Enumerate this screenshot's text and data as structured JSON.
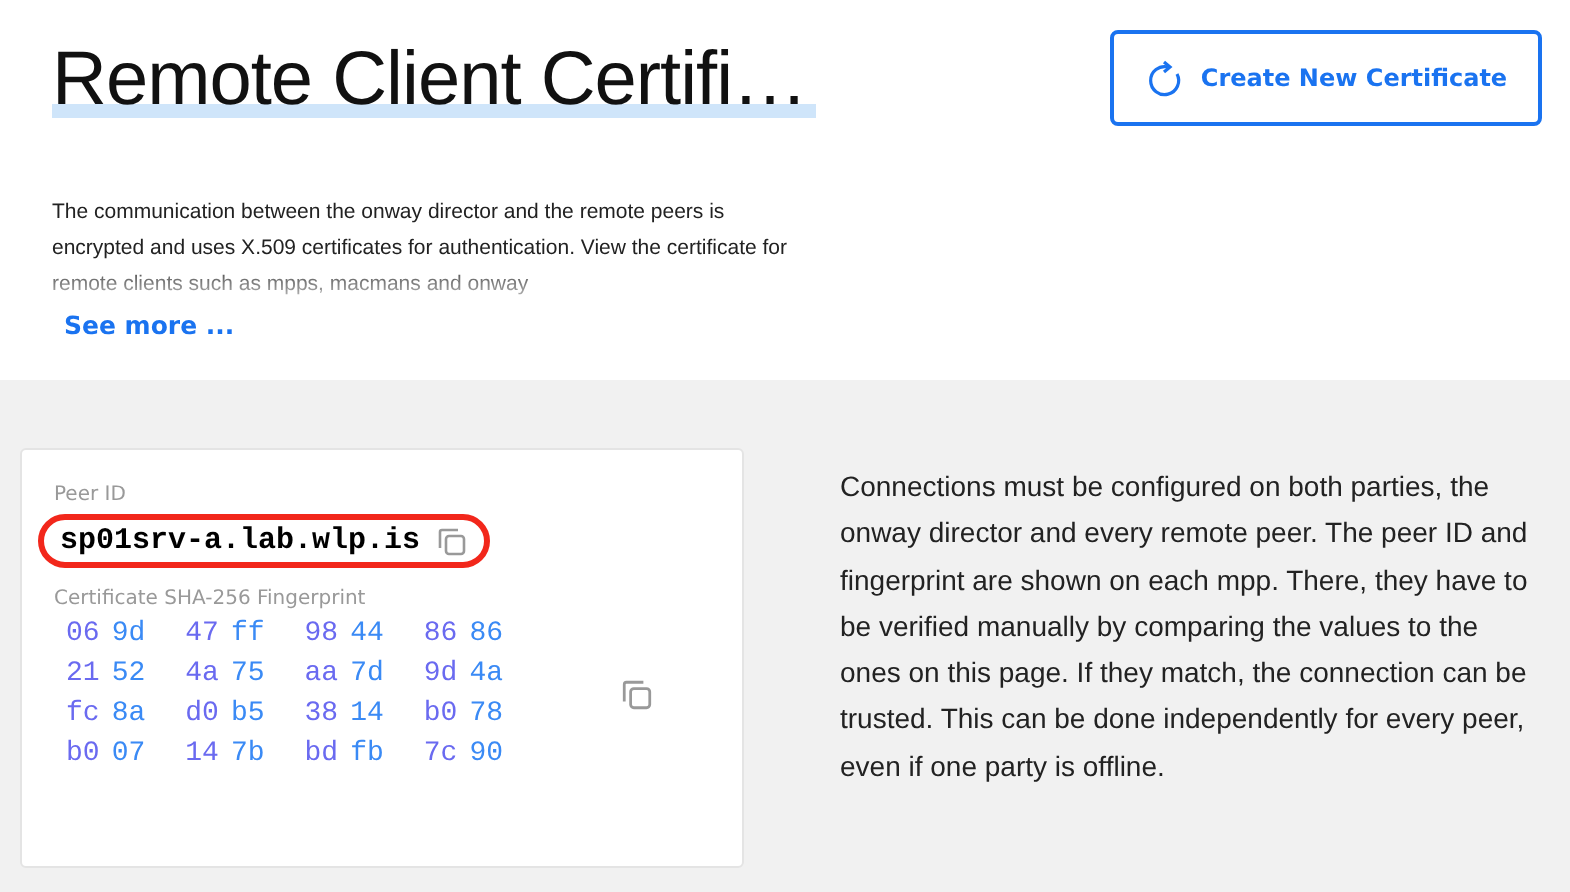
{
  "header": {
    "title": "Remote Client Certifi…",
    "description": "The communication between the onway director and the remote peers is encrypted and uses X.509 certificates for authentication. View the certificate for remote clients such as mpps, macmans and onway",
    "see_more": "See more ...",
    "create_button": "Create New Certificate"
  },
  "certificate": {
    "peer_id_label": "Peer ID",
    "peer_id": "sp01srv-a.lab.wlp.is",
    "peer_id_highlighted": true,
    "fingerprint_label": "Certificate SHA-256 Fingerprint",
    "fingerprint_rows": [
      [
        {
          "text": "06",
          "color": "#6a6af0"
        },
        {
          "text": "9d",
          "color": "#3a8af5"
        },
        {
          "text": "47",
          "color": "#6a6af0"
        },
        {
          "text": "ff",
          "color": "#3a8af5"
        },
        {
          "text": "98",
          "color": "#6a6af0"
        },
        {
          "text": "44",
          "color": "#3a8af5"
        },
        {
          "text": "86",
          "color": "#6a6af0"
        },
        {
          "text": "86",
          "color": "#3a8af5"
        }
      ],
      [
        {
          "text": "21",
          "color": "#6a6af0"
        },
        {
          "text": "52",
          "color": "#3a8af5"
        },
        {
          "text": "4a",
          "color": "#6a6af0"
        },
        {
          "text": "75",
          "color": "#3a8af5"
        },
        {
          "text": "aa",
          "color": "#6a6af0"
        },
        {
          "text": "7d",
          "color": "#3a8af5"
        },
        {
          "text": "9d",
          "color": "#6a6af0"
        },
        {
          "text": "4a",
          "color": "#3a8af5"
        }
      ],
      [
        {
          "text": "fc",
          "color": "#6a6af0"
        },
        {
          "text": "8a",
          "color": "#3a8af5"
        },
        {
          "text": "d0",
          "color": "#6a6af0"
        },
        {
          "text": "b5",
          "color": "#3a8af5"
        },
        {
          "text": "38",
          "color": "#6a6af0"
        },
        {
          "text": "14",
          "color": "#3a8af5"
        },
        {
          "text": "b0",
          "color": "#6a6af0"
        },
        {
          "text": "78",
          "color": "#3a8af5"
        }
      ],
      [
        {
          "text": "b0",
          "color": "#6a6af0"
        },
        {
          "text": "07",
          "color": "#3a8af5"
        },
        {
          "text": "14",
          "color": "#6a6af0"
        },
        {
          "text": "7b",
          "color": "#3a8af5"
        },
        {
          "text": "bd",
          "color": "#6a6af0"
        },
        {
          "text": "fb",
          "color": "#3a8af5"
        },
        {
          "text": "7c",
          "color": "#6a6af0"
        },
        {
          "text": "90",
          "color": "#3a8af5"
        }
      ]
    ]
  },
  "info_text": "Connections must be configured on both parties, the onway director and every remote peer. The peer ID and fingerprint are shown on each mpp. There, they have to be verified manually by comparing the values to the ones on this page. If they match, the connection can be trusted. This can be done independently for every peer, even if one party is offline."
}
